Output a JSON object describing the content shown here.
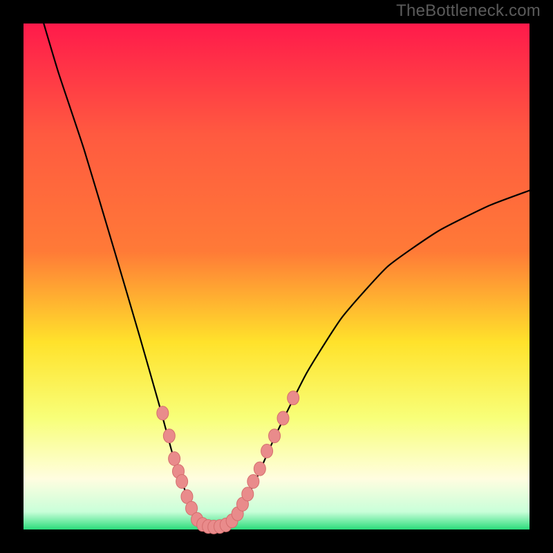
{
  "watermark": {
    "text": "TheBottleneck.com"
  },
  "colors": {
    "frame": "#000000",
    "gradient_top": "#ff1a4b",
    "gradient_mid_upper": "#ff7a37",
    "gradient_mid": "#ffe22b",
    "gradient_lower": "#f8ff79",
    "gradient_pale": "#fffde0",
    "gradient_bottom_green": "#2bdc7b",
    "curve": "#000000",
    "marker_fill": "#e98b8b",
    "marker_stroke": "#d46d6d"
  },
  "chart_data": {
    "type": "line",
    "title": "",
    "xlabel": "",
    "ylabel": "",
    "xlim": [
      0,
      100
    ],
    "ylim": [
      0,
      100
    ],
    "legend": false,
    "grid": false,
    "curve": {
      "description": "V-shaped bottleneck curve; left branch steep, right branch rises then levels off",
      "points": [
        {
          "x": 4.0,
          "y": 100.0
        },
        {
          "x": 7.0,
          "y": 90.0
        },
        {
          "x": 12.0,
          "y": 75.0
        },
        {
          "x": 18.0,
          "y": 55.0
        },
        {
          "x": 23.0,
          "y": 38.0
        },
        {
          "x": 27.0,
          "y": 24.0
        },
        {
          "x": 30.0,
          "y": 13.0
        },
        {
          "x": 33.0,
          "y": 5.0
        },
        {
          "x": 35.0,
          "y": 1.5
        },
        {
          "x": 37.0,
          "y": 0.6
        },
        {
          "x": 39.0,
          "y": 0.6
        },
        {
          "x": 41.0,
          "y": 1.3
        },
        {
          "x": 43.0,
          "y": 4.0
        },
        {
          "x": 46.0,
          "y": 10.0
        },
        {
          "x": 50.0,
          "y": 19.0
        },
        {
          "x": 56.0,
          "y": 31.0
        },
        {
          "x": 63.0,
          "y": 42.0
        },
        {
          "x": 72.0,
          "y": 52.0
        },
        {
          "x": 82.0,
          "y": 59.0
        },
        {
          "x": 92.0,
          "y": 64.0
        },
        {
          "x": 100.0,
          "y": 67.0
        }
      ]
    },
    "markers": [
      {
        "x": 27.5,
        "y": 23.0
      },
      {
        "x": 28.8,
        "y": 18.5
      },
      {
        "x": 29.8,
        "y": 14.0
      },
      {
        "x": 30.6,
        "y": 11.5
      },
      {
        "x": 31.3,
        "y": 9.5
      },
      {
        "x": 32.3,
        "y": 6.5
      },
      {
        "x": 33.2,
        "y": 4.2
      },
      {
        "x": 34.3,
        "y": 2.0
      },
      {
        "x": 35.4,
        "y": 1.0
      },
      {
        "x": 36.5,
        "y": 0.6
      },
      {
        "x": 37.6,
        "y": 0.5
      },
      {
        "x": 38.8,
        "y": 0.6
      },
      {
        "x": 40.0,
        "y": 0.9
      },
      {
        "x": 41.2,
        "y": 1.7
      },
      {
        "x": 42.3,
        "y": 3.1
      },
      {
        "x": 43.3,
        "y": 5.0
      },
      {
        "x": 44.3,
        "y": 7.0
      },
      {
        "x": 45.4,
        "y": 9.5
      },
      {
        "x": 46.7,
        "y": 12.0
      },
      {
        "x": 48.1,
        "y": 15.5
      },
      {
        "x": 49.6,
        "y": 18.5
      },
      {
        "x": 51.3,
        "y": 22.0
      },
      {
        "x": 53.3,
        "y": 26.0
      }
    ]
  }
}
